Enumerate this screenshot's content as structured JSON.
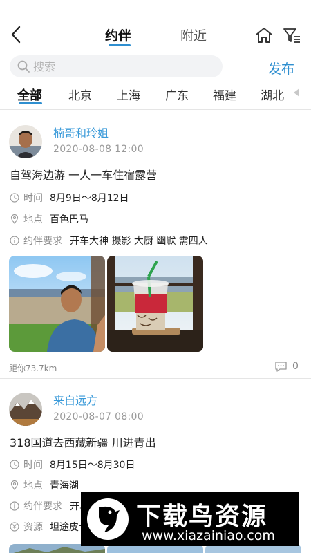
{
  "header": {
    "tabs": [
      {
        "label": "约伴",
        "active": true
      },
      {
        "label": "附近",
        "active": false
      }
    ],
    "icons": [
      "back-icon",
      "home-icon",
      "filter-icon"
    ]
  },
  "search": {
    "placeholder": "搜索",
    "value": ""
  },
  "publish_label": "发布",
  "regions": {
    "items": [
      "全部",
      "北京",
      "上海",
      "广东",
      "福建",
      "湖北"
    ],
    "selected": "全部"
  },
  "accent_color": "#2f8fd0",
  "username_color": "#3a9ad9",
  "posts": [
    {
      "username": "楠哥和玲姐",
      "timestamp": "2020-08-08 12:00",
      "title": "自驾海边游 一人一车住宿露营",
      "time_label": "时间",
      "time_value": "8月9日～8月12日",
      "location_label": "地点",
      "location_value": "百色巴马",
      "requirement_label": "约伴要求",
      "requirement_value": "开车大神 摄影 大厨 幽默 需四人",
      "distance": "距你73.7km",
      "comment_count": "0"
    },
    {
      "username": "来自远方",
      "timestamp": "2020-08-07 08:00",
      "title": "318国道去西藏新疆 川进青出",
      "time_label": "时间",
      "time_value": "8月15日～8月30日",
      "location_label": "地点",
      "location_value": "青海湖",
      "requirement_label": "约伴要求",
      "requirement_value": "开车",
      "resource_label": "资源",
      "resource_value": "坦途皮卡"
    }
  ],
  "watermark": {
    "title": "下载鸟资源",
    "url": "www.xiazainiao.com"
  }
}
